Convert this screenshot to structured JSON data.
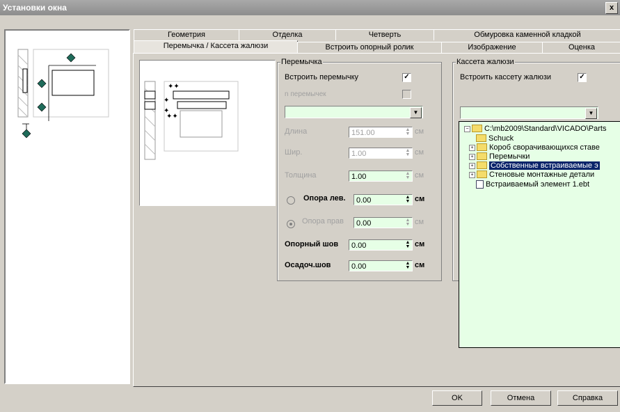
{
  "window": {
    "title": "Установки окна",
    "close": "x"
  },
  "tabs_row1": [
    "Геометрия",
    "Отделка",
    "Четверть",
    "Обмуровка каменной кладкой"
  ],
  "tabs_row2": [
    "Перемычка / Кассета жалюзи",
    "Встроить опорный ролик",
    "Изображение",
    "Оценка"
  ],
  "lintel": {
    "group_title": "Перемычка",
    "insert_label": "Встроить перемычку",
    "insert_checked": "✓",
    "n_label": "n перемычек",
    "length_label": "Длина",
    "length_value": "151.00",
    "width_label": "Шир.",
    "width_value": "1.00",
    "thick_label": "Толщина",
    "thick_value": "1.00",
    "support_left_label": "Опора лев.",
    "support_left_value": "0.00",
    "support_right_label": "Опора прав",
    "support_right_value": "0.00",
    "support_seam_label": "Опорный шов",
    "support_seam_value": "0.00",
    "settle_seam_label": "Осадоч.шов",
    "settle_seam_value": "0.00",
    "unit": "см"
  },
  "shutter": {
    "group_title": "Кассета жалюзи",
    "insert_label": "Встроить кассету жалюзи",
    "insert_checked": "✓"
  },
  "tree": {
    "root": "C:\\mb2009\\Standard\\VICADO\\Parts",
    "items": [
      "Schuck",
      "Короб сворачивающихся ставе",
      "Перемычки",
      "Собственные встраиваемые э",
      "Стеновые монтажные детали",
      "Встраиваемый элемент 1.ebt"
    ]
  },
  "buttons": {
    "ok": "OK",
    "cancel": "Отмена",
    "help": "Справка"
  }
}
